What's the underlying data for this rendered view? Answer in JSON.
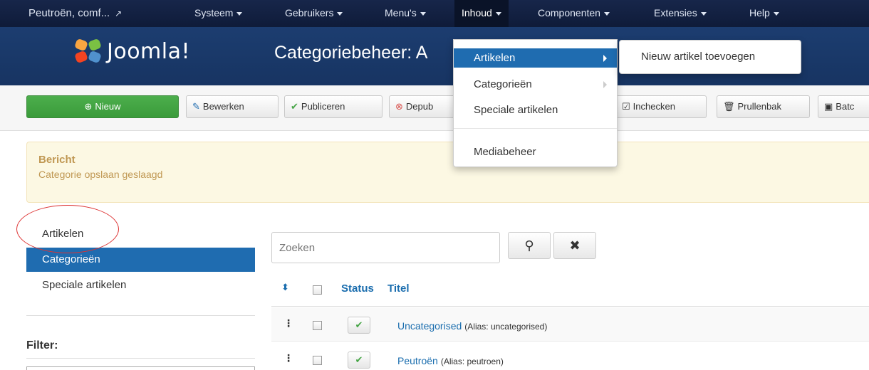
{
  "topnav": {
    "site": "Peutroën, comf...",
    "items": [
      "Systeem",
      "Gebruikers",
      "Menu's",
      "Inhoud",
      "Componenten",
      "Extensies",
      "Help"
    ]
  },
  "header": {
    "logo": "Joomla!",
    "title": "Categoriebeheer: A"
  },
  "toolbar": {
    "new": "Nieuw",
    "edit": "Bewerken",
    "publish": "Publiceren",
    "unpublish": "Depub",
    "checkin": "Inchecken",
    "trash": "Prullenbak",
    "batch": "Batc"
  },
  "message": {
    "heading": "Bericht",
    "body": "Categorie opslaan geslaagd"
  },
  "sidebar": {
    "items": [
      "Artikelen",
      "Categorieën",
      "Speciale artikelen"
    ],
    "filter_label": "Filter:"
  },
  "search": {
    "placeholder": "Zoeken"
  },
  "table": {
    "headers": {
      "status": "Status",
      "title": "Titel"
    },
    "rows": [
      {
        "title": "Uncategorised",
        "alias": "(Alias: uncategorised)"
      },
      {
        "title": "Peutroën",
        "alias": "(Alias: peutroen)"
      }
    ]
  },
  "dropdown": {
    "items": [
      "Artikelen",
      "Categorieën",
      "Speciale artikelen",
      "Mediabeheer"
    ],
    "submenu": "Nieuw artikel toevoegen"
  },
  "colors": {
    "nav_bg": "#0f1d3a",
    "header_bg": "#1a3867",
    "accent": "#1f6cb0",
    "success": "#46a546"
  }
}
